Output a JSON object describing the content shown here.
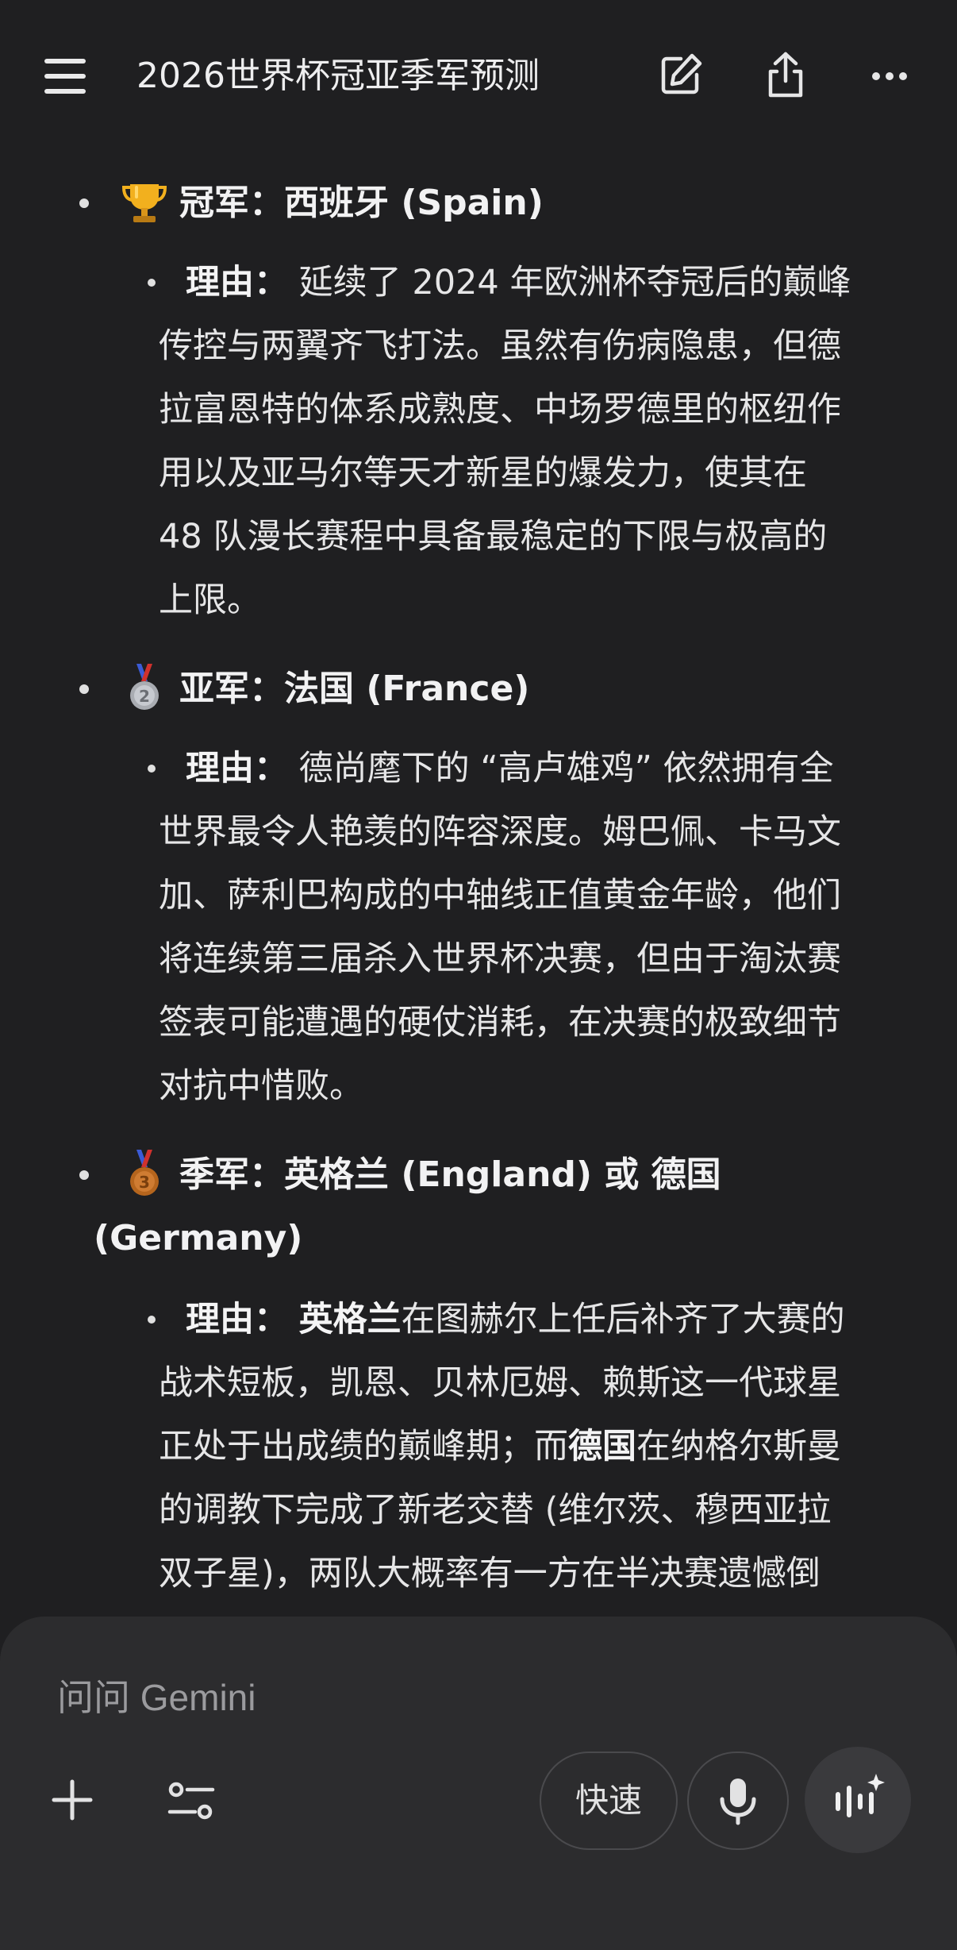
{
  "header": {
    "title": "2026世界杯冠亚季军预测",
    "icons": [
      "menu-icon",
      "edit-icon",
      "share-icon",
      "more-icon"
    ]
  },
  "content": {
    "champion": {
      "heading": "冠军：西班牙 (Spain)",
      "reason_label": "理由：",
      "reason_lines": [
        "延续了 2024 年欧洲杯夺冠后的巅峰",
        "传控与两翼齐飞打法。虽然有伤病隐患，但德",
        "拉富恩特的体系成熟度、中场罗德里的枢纽作",
        "用以及亚马尔等天才新星的爆发力，使其在",
        "48 队漫长赛程中具备最稳定的下限与极高的",
        "上限。"
      ]
    },
    "runner_up": {
      "heading": "亚军：法国 (France)",
      "reason_label": "理由：",
      "reason_lines": [
        "德尚麾下的 “高卢雄鸡” 依然拥有全",
        "世界最令人艳羡的阵容深度。姆巴佩、卡马文",
        "加、萨利巴构成的中轴线正值黄金年龄，他们",
        "将连续第三届杀入世界杯决赛，但由于淘汰赛",
        "签表可能遭遇的硬仗消耗，在决赛的极致细节",
        "对抗中惜败。"
      ]
    },
    "third": {
      "heading_line1": "季军：英格兰 (England) 或 德国",
      "heading_line2": "(Germany)",
      "reason_label": "理由：",
      "line1_bold": "英格兰",
      "line1_rest": "在图赫尔上任后补齐了大赛的",
      "line2": "战术短板，凯恩、贝林厄姆、赖斯这一代球星",
      "line3_pre": "正处于出成绩的巅峰期；而",
      "line3_bold": "德国",
      "line3_rest": "在纳格尔斯曼",
      "line4": "的调教下完成了新老交替 (维尔茨、穆西亚拉",
      "line5": "双子星)，两队大概率有一方在半决赛遗憾倒"
    },
    "emojis": {
      "champion": "trophy-icon",
      "runner_up": "silver-medal-icon",
      "third": "bronze-medal-icon"
    }
  },
  "input": {
    "placeholder": "问问 Gemini",
    "fast_label": "快速"
  },
  "colors": {
    "background": "#1f1f21",
    "panel": "#2c2c2e",
    "text": "#e9e9ea",
    "placeholder": "#9b9b9e"
  }
}
